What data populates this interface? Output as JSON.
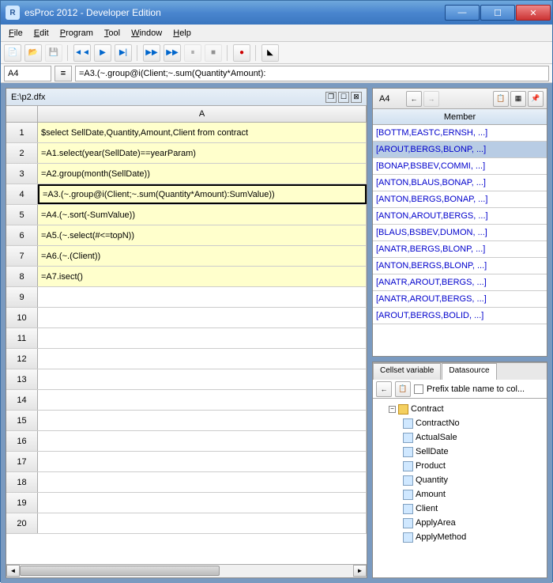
{
  "window": {
    "title": "esProc 2012 - Developer Edition"
  },
  "menu": {
    "file": "File",
    "edit": "Edit",
    "program": "Program",
    "tool": "Tool",
    "window": "Window",
    "help": "Help"
  },
  "formulabar": {
    "cell": "A4",
    "formula": "=A3.(~.group@i(Client;~.sum(Quantity*Amount):"
  },
  "doc": {
    "title": "E:\\p2.dfx",
    "colA": "A"
  },
  "rows": [
    {
      "n": "1",
      "v": "$select SellDate,Quantity,Amount,Client from contract"
    },
    {
      "n": "2",
      "v": "=A1.select(year(SellDate)==yearParam)"
    },
    {
      "n": "3",
      "v": "=A2.group(month(SellDate))"
    },
    {
      "n": "4",
      "v": "=A3.(~.group@i(Client;~.sum(Quantity*Amount):SumValue))"
    },
    {
      "n": "5",
      "v": "=A4.(~.sort(-SumValue))"
    },
    {
      "n": "6",
      "v": "=A5.(~.select(#<=topN))"
    },
    {
      "n": "7",
      "v": "=A6.(~.(Client))"
    },
    {
      "n": "8",
      "v": "=A7.isect()"
    },
    {
      "n": "9",
      "v": ""
    },
    {
      "n": "10",
      "v": ""
    },
    {
      "n": "11",
      "v": ""
    },
    {
      "n": "12",
      "v": ""
    },
    {
      "n": "13",
      "v": ""
    },
    {
      "n": "14",
      "v": ""
    },
    {
      "n": "15",
      "v": ""
    },
    {
      "n": "16",
      "v": ""
    },
    {
      "n": "17",
      "v": ""
    },
    {
      "n": "18",
      "v": ""
    },
    {
      "n": "19",
      "v": ""
    },
    {
      "n": "20",
      "v": ""
    }
  ],
  "right": {
    "cell": "A4",
    "header": "Member",
    "items": [
      "[BOTTM,EASTC,ERNSH, ...]",
      "[AROUT,BERGS,BLONP, ...]",
      "[BONAP,BSBEV,COMMI, ...]",
      "[ANTON,BLAUS,BONAP, ...]",
      "[ANTON,BERGS,BONAP, ...]",
      "[ANTON,AROUT,BERGS, ...]",
      "[BLAUS,BSBEV,DUMON, ...]",
      "[ANATR,BERGS,BLONP, ...]",
      "[ANTON,BERGS,BLONP, ...]",
      "[ANATR,AROUT,BERGS, ...]",
      "[ANATR,AROUT,BERGS, ...]",
      "[AROUT,BERGS,BOLID, ...]"
    ],
    "selectedIndex": 1
  },
  "tabs": {
    "cellset": "Cellset variable",
    "datasource": "Datasource"
  },
  "ds": {
    "prefix": "Prefix table name to col...",
    "root": "Contract",
    "fields": [
      "ContractNo",
      "ActualSale",
      "SellDate",
      "Product",
      "Quantity",
      "Amount",
      "Client",
      "ApplyArea",
      "ApplyMethod"
    ]
  }
}
